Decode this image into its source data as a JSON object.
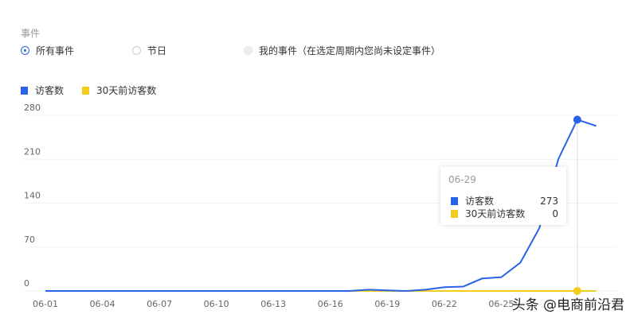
{
  "events": {
    "label": "事件",
    "options": [
      {
        "label": "所有事件",
        "state": "selected"
      },
      {
        "label": "节日",
        "state": "unselected"
      },
      {
        "label": "我的事件（在选定周期内您尚未设定事件）",
        "state": "disabled"
      }
    ]
  },
  "chart_data": {
    "type": "line",
    "x": [
      "06-01",
      "06-02",
      "06-03",
      "06-04",
      "06-05",
      "06-06",
      "06-07",
      "06-08",
      "06-09",
      "06-10",
      "06-11",
      "06-12",
      "06-13",
      "06-14",
      "06-15",
      "06-16",
      "06-17",
      "06-18",
      "06-19",
      "06-20",
      "06-21",
      "06-22",
      "06-23",
      "06-24",
      "06-25",
      "06-26",
      "06-27",
      "06-28",
      "06-29",
      "06-30"
    ],
    "xticks": [
      "06-01",
      "06-04",
      "06-07",
      "06-10",
      "06-13",
      "06-16",
      "06-19",
      "06-22",
      "06-25"
    ],
    "yticks": [
      0,
      70,
      140,
      210,
      280
    ],
    "ylim": [
      0,
      280
    ],
    "series": [
      {
        "name": "访客数",
        "color": "#2762e9",
        "values": [
          0,
          0,
          0,
          0,
          0,
          0,
          0,
          0,
          0,
          0,
          0,
          0,
          0,
          0,
          0,
          0,
          0,
          2,
          1,
          0,
          2,
          6,
          7,
          20,
          22,
          45,
          100,
          210,
          273,
          263
        ]
      },
      {
        "name": "30天前访客数",
        "color": "#f2cd1d",
        "values": [
          0,
          0,
          0,
          0,
          0,
          0,
          0,
          0,
          0,
          0,
          0,
          0,
          0,
          0,
          0,
          0,
          0,
          0,
          0,
          0,
          0,
          0,
          0,
          0,
          0,
          0,
          0,
          0,
          0,
          0
        ]
      }
    ],
    "legend": "top-left",
    "grid": true
  },
  "tooltip": {
    "date": "06-29",
    "rows": [
      {
        "name": "访客数",
        "value": "273"
      },
      {
        "name": "30天前访客数",
        "value": "0"
      }
    ]
  },
  "watermark": "头条 @电商前沿君"
}
